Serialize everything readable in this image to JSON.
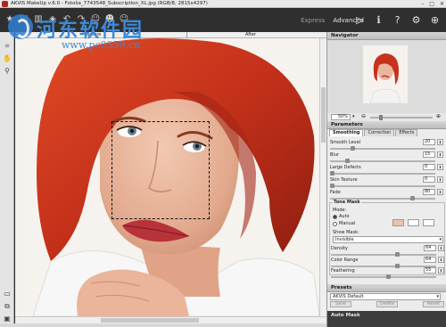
{
  "window": {
    "title": "AKVIS MakeUp v.6.0 - Fotolia_7743548_Subscription_XL.jpg (RGB/8, 2815x4297)",
    "minimize": "–",
    "maximize": "□",
    "close": "✕"
  },
  "toolbar": {
    "modes": [
      "Express",
      "Advanced"
    ],
    "active_mode": "Advanced"
  },
  "watermark": {
    "text": "河东软件园",
    "url": "www.pc0359.cn"
  },
  "canvas": {
    "before_label": "Before",
    "after_label": "After"
  },
  "navigator": {
    "title": "Navigator",
    "zoom": "50%"
  },
  "parameters": {
    "title": "Parameters",
    "tabs": [
      "Smoothing",
      "Correction",
      "Effects"
    ],
    "active_tab": "Smoothing",
    "sliders": [
      {
        "label": "Smooth Level",
        "value": "20",
        "level": 0.2
      },
      {
        "label": "Blur",
        "value": "15",
        "level": 0.15
      },
      {
        "label": "Large Defects",
        "value": "0",
        "level": 0.0
      },
      {
        "label": "Skin Texture",
        "value": "0",
        "level": 0.0
      },
      {
        "label": "Fade",
        "value": "80",
        "level": 0.8
      }
    ]
  },
  "tone_mask": {
    "title": "Tone Mask",
    "mode_label": "Mode:",
    "auto_label": "Auto",
    "manual_label": "Manual",
    "selected_mode": "Auto",
    "swatch_colors": [
      "#e8c3b1",
      "#ffffff",
      "#ffffff"
    ],
    "show_mask_label": "Show Mask:",
    "show_mask_value": "Invisible",
    "sliders": [
      {
        "label": "Density",
        "value": "64",
        "level": 0.64
      },
      {
        "label": "Color Range",
        "value": "64",
        "level": 0.64
      },
      {
        "label": "Feathering",
        "value": "55",
        "level": 0.55
      }
    ]
  },
  "presets": {
    "title": "Presets",
    "current": "AKVIS Default",
    "save": "Save",
    "delete": "Delete",
    "reset": "Reset"
  },
  "auto_mask": {
    "title": "Auto Mask"
  },
  "colors": {
    "hair": "#c8321c",
    "skin": "#e8b8a0",
    "lips": "#b8323a",
    "panel_bg": "#ececec"
  }
}
